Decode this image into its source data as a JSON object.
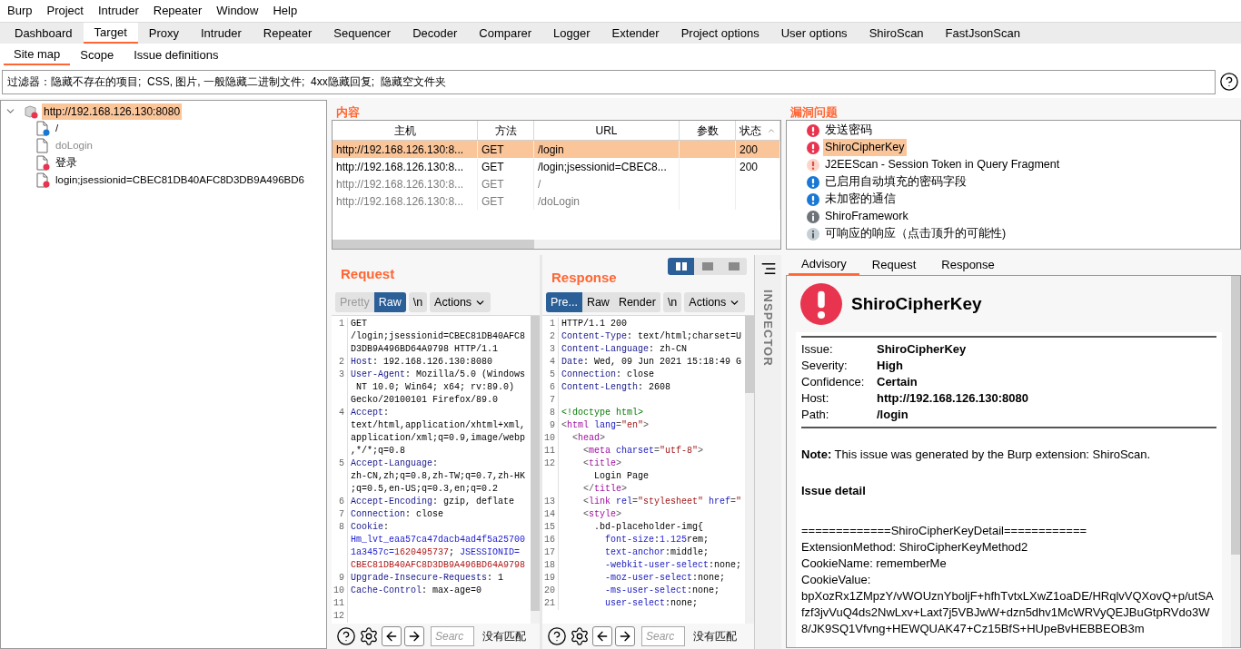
{
  "menu": [
    "Burp",
    "Project",
    "Intruder",
    "Repeater",
    "Window",
    "Help"
  ],
  "tabs": [
    {
      "label": "Dashboard",
      "selected": false
    },
    {
      "label": "Target",
      "selected": true
    },
    {
      "label": "Proxy",
      "selected": false
    },
    {
      "label": "Intruder",
      "selected": false
    },
    {
      "label": "Repeater",
      "selected": false
    },
    {
      "label": "Sequencer",
      "selected": false
    },
    {
      "label": "Decoder",
      "selected": false
    },
    {
      "label": "Comparer",
      "selected": false
    },
    {
      "label": "Logger",
      "selected": false
    },
    {
      "label": "Extender",
      "selected": false
    },
    {
      "label": "Project options",
      "selected": false
    },
    {
      "label": "User options",
      "selected": false
    },
    {
      "label": "ShiroScan",
      "selected": false
    },
    {
      "label": "FastJsonScan",
      "selected": false
    }
  ],
  "subtabs": [
    {
      "label": "Site map",
      "selected": true
    },
    {
      "label": "Scope",
      "selected": false
    },
    {
      "label": "Issue definitions",
      "selected": false
    }
  ],
  "filter": "过滤器：隐藏不存在的项目;  CSS, 图片, 一般隐藏二进制文件;  4xx隐藏回复;  隐藏空文件夹",
  "site_tree": [
    {
      "label": "http://192.168.126.130:8080",
      "selected": true,
      "expanded": true,
      "color": "#e8344e",
      "dimmed": false,
      "children": [
        {
          "label": "/",
          "selected": false,
          "color": "#1a78d4",
          "dimmed": false
        },
        {
          "label": "doLogin",
          "selected": false,
          "dimmed": true
        },
        {
          "label": "登录",
          "selected": false,
          "color": "#e8344e",
          "dimmed": false
        },
        {
          "label": "login;jsessionid=CBEC81DB40AFC8D3DB9A496BD6",
          "selected": false,
          "color": "#e8344e",
          "dimmed": false
        }
      ]
    }
  ],
  "content": {
    "title": "内容",
    "columns": [
      "主机",
      "方法",
      "URL",
      "参数",
      "状态"
    ],
    "rows": [
      {
        "cells": [
          "http://192.168.126.130:8...",
          "GET",
          "/login",
          "",
          "200"
        ],
        "selected": true,
        "dimmed": false
      },
      {
        "cells": [
          "http://192.168.126.130:8...",
          "GET",
          "/login;jsessionid=CBEC8...",
          "",
          "200"
        ],
        "selected": false,
        "dimmed": false
      },
      {
        "cells": [
          "http://192.168.126.130:8...",
          "GET",
          "/",
          "",
          ""
        ],
        "selected": false,
        "dimmed": true
      },
      {
        "cells": [
          "http://192.168.126.130:8...",
          "GET",
          "/doLogin",
          "",
          ""
        ],
        "selected": false,
        "dimmed": true
      }
    ]
  },
  "issues": {
    "title": "漏洞问题",
    "items": [
      {
        "label": "发送密码",
        "kind": "high",
        "selected": false
      },
      {
        "label": "ShiroCipherKey",
        "kind": "high",
        "selected": true
      },
      {
        "label": "J2EEScan - Session Token in Query Fragment",
        "kind": "tentative",
        "selected": false
      },
      {
        "label": "已启用自动填充的密码字段",
        "kind": "low",
        "selected": false
      },
      {
        "label": "未加密的通信",
        "kind": "low",
        "selected": false
      },
      {
        "label": "ShiroFramework",
        "kind": "info",
        "selected": false
      },
      {
        "label": "可响应的响应（点击顶升的可能性)",
        "kind": "hint",
        "selected": false
      }
    ]
  },
  "request": {
    "title": "Request",
    "views": [
      {
        "label": "Pretty",
        "selected": false,
        "disabled": true
      },
      {
        "label": "Raw",
        "selected": true,
        "disabled": false
      }
    ],
    "newline": "\\n",
    "actions": "Actions",
    "search_placeholder": "Searc",
    "match": "没有匹配",
    "lines": [
      {
        "n": "1",
        "s": [
          {
            "kind": "plain",
            "text": "GET"
          }
        ]
      },
      {
        "s": [
          {
            "kind": "plain",
            "text": "/login;jsessionid=CBEC81DB40AFC8"
          }
        ]
      },
      {
        "s": [
          {
            "kind": "plain",
            "text": "D3DB9A496BD64A9798 HTTP/1.1"
          }
        ]
      },
      {
        "n": "2",
        "s": [
          {
            "kind": "key",
            "text": "Host"
          },
          {
            "kind": "plain",
            "text": ": 192.168.126.130:8080"
          }
        ]
      },
      {
        "n": "3",
        "s": [
          {
            "kind": "key",
            "text": "User-Agent"
          },
          {
            "kind": "plain",
            "text": ": Mozilla/5.0 (Windows"
          }
        ]
      },
      {
        "s": [
          {
            "kind": "plain",
            "text": " NT 10.0; Win64; x64; rv:89.0)"
          }
        ]
      },
      {
        "s": [
          {
            "kind": "plain",
            "text": "Gecko/20100101 Firefox/89.0"
          }
        ]
      },
      {
        "n": "4",
        "s": [
          {
            "kind": "key",
            "text": "Accept"
          },
          {
            "kind": "plain",
            "text": ":"
          }
        ]
      },
      {
        "s": [
          {
            "kind": "plain",
            "text": "text/html,application/xhtml+xml,"
          }
        ]
      },
      {
        "s": [
          {
            "kind": "plain",
            "text": "application/xml;q=0.9,image/webp"
          }
        ]
      },
      {
        "s": [
          {
            "kind": "plain",
            "text": ",*/*;q=0.8"
          }
        ]
      },
      {
        "n": "5",
        "s": [
          {
            "kind": "key",
            "text": "Accept-Language"
          },
          {
            "kind": "plain",
            "text": ":"
          }
        ]
      },
      {
        "s": [
          {
            "kind": "plain",
            "text": "zh-CN,zh;q=0.8,zh-TW;q=0.7,zh-HK"
          }
        ]
      },
      {
        "s": [
          {
            "kind": "plain",
            "text": ";q=0.5,en-US;q=0.3,en;q=0.2"
          }
        ]
      },
      {
        "n": "6",
        "s": [
          {
            "kind": "key",
            "text": "Accept-Encoding"
          },
          {
            "kind": "plain",
            "text": ": gzip, deflate"
          }
        ]
      },
      {
        "n": "7",
        "s": [
          {
            "kind": "key",
            "text": "Connection"
          },
          {
            "kind": "plain",
            "text": ": close"
          }
        ]
      },
      {
        "n": "8",
        "s": [
          {
            "kind": "key",
            "text": "Cookie"
          },
          {
            "kind": "plain",
            "text": ":"
          }
        ]
      },
      {
        "s": [
          {
            "kind": "cname",
            "text": "Hm_lvt_eaa57ca47dacb4ad4f5a25700"
          }
        ]
      },
      {
        "s": [
          {
            "kind": "cname",
            "text": "1a3457c="
          },
          {
            "kind": "cval",
            "text": "1620495737"
          },
          {
            "kind": "plain",
            "text": "; "
          },
          {
            "kind": "cname",
            "text": "JSESSIONID="
          }
        ]
      },
      {
        "s": [
          {
            "kind": "cval",
            "text": "CBEC81DB40AFC8D3DB9A496BD64A9798"
          }
        ]
      },
      {
        "n": "9",
        "s": [
          {
            "kind": "key",
            "text": "Upgrade-Insecure-Requests"
          },
          {
            "kind": "plain",
            "text": ": 1"
          }
        ]
      },
      {
        "n": "10",
        "s": [
          {
            "kind": "key",
            "text": "Cache-Control"
          },
          {
            "kind": "plain",
            "text": ": max-age=0"
          }
        ]
      },
      {
        "n": "11"
      },
      {
        "n": "12"
      }
    ]
  },
  "response": {
    "title": "Response",
    "layouts": [
      {
        "selected": true
      },
      {
        "selected": false
      },
      {
        "selected": false
      }
    ],
    "views": [
      {
        "label": "Pre...",
        "selected": true,
        "disabled": false
      },
      {
        "label": "Raw",
        "selected": false,
        "disabled": false
      },
      {
        "label": "Render",
        "selected": false,
        "disabled": false
      }
    ],
    "newline": "\\n",
    "actions": "Actions",
    "search_placeholder": "Searc",
    "match": "没有匹配",
    "lines": [
      {
        "n": "1",
        "s": [
          {
            "kind": "plain",
            "text": "HTTP/1.1 200"
          }
        ]
      },
      {
        "n": "2",
        "s": [
          {
            "kind": "key",
            "text": "Content-Type"
          },
          {
            "kind": "plain",
            "text": ": text/html;charset=U"
          }
        ]
      },
      {
        "n": "3",
        "s": [
          {
            "kind": "key",
            "text": "Content-Language"
          },
          {
            "kind": "plain",
            "text": ": zh-CN"
          }
        ]
      },
      {
        "n": "4",
        "s": [
          {
            "kind": "key",
            "text": "Date"
          },
          {
            "kind": "plain",
            "text": ": Wed, 09 Jun 2021 15:18:49 G"
          }
        ]
      },
      {
        "n": "5",
        "s": [
          {
            "kind": "key",
            "text": "Connection"
          },
          {
            "kind": "plain",
            "text": ": close"
          }
        ]
      },
      {
        "n": "6",
        "s": [
          {
            "kind": "key",
            "text": "Content-Length"
          },
          {
            "kind": "plain",
            "text": ": 2608"
          }
        ]
      },
      {
        "n": "7"
      },
      {
        "n": "8",
        "s": [
          {
            "kind": "doctype",
            "text": "<!doctype html>"
          }
        ]
      },
      {
        "n": "9",
        "s": [
          {
            "kind": "punct",
            "text": "<"
          },
          {
            "kind": "tag",
            "text": "html"
          },
          {
            "kind": "attr",
            "text": " lang"
          },
          {
            "kind": "punct",
            "text": "="
          },
          {
            "kind": "str",
            "text": "\"en\""
          },
          {
            "kind": "punct",
            "text": ">"
          }
        ]
      },
      {
        "n": "10",
        "s": [
          {
            "kind": "punct",
            "text": "  <"
          },
          {
            "kind": "tag",
            "text": "head"
          },
          {
            "kind": "punct",
            "text": ">"
          }
        ]
      },
      {
        "n": "11",
        "s": [
          {
            "kind": "punct",
            "text": "    <"
          },
          {
            "kind": "tag",
            "text": "meta"
          },
          {
            "kind": "attr",
            "text": " charset"
          },
          {
            "kind": "punct",
            "text": "="
          },
          {
            "kind": "str",
            "text": "\"utf-8\""
          },
          {
            "kind": "punct",
            "text": ">"
          }
        ]
      },
      {
        "n": "12",
        "s": [
          {
            "kind": "punct",
            "text": "    <"
          },
          {
            "kind": "tag",
            "text": "title"
          },
          {
            "kind": "punct",
            "text": ">"
          }
        ]
      },
      {
        "s": [
          {
            "kind": "plain",
            "text": "      Login Page"
          }
        ]
      },
      {
        "s": [
          {
            "kind": "punct",
            "text": "    </"
          },
          {
            "kind": "tag",
            "text": "title"
          },
          {
            "kind": "punct",
            "text": ">"
          }
        ]
      },
      {
        "n": "13",
        "s": [
          {
            "kind": "punct",
            "text": "    <"
          },
          {
            "kind": "tag",
            "text": "link"
          },
          {
            "kind": "attr",
            "text": " rel"
          },
          {
            "kind": "punct",
            "text": "="
          },
          {
            "kind": "str",
            "text": "\"stylesheet\""
          },
          {
            "kind": "attr",
            "text": " href"
          },
          {
            "kind": "punct",
            "text": "="
          },
          {
            "kind": "str",
            "text": "\""
          }
        ]
      },
      {
        "n": "14",
        "s": [
          {
            "kind": "punct",
            "text": "    <"
          },
          {
            "kind": "tag",
            "text": "style"
          },
          {
            "kind": "punct",
            "text": ">"
          }
        ]
      },
      {
        "n": "15",
        "s": [
          {
            "kind": "plain",
            "text": "      .bd-placeholder-img{"
          }
        ]
      },
      {
        "n": "16",
        "s": [
          {
            "kind": "prop",
            "text": "        font-size"
          },
          {
            "kind": "plain",
            "text": ":"
          },
          {
            "kind": "num",
            "text": "1.125"
          },
          {
            "kind": "plain",
            "text": "rem;"
          }
        ]
      },
      {
        "n": "17",
        "s": [
          {
            "kind": "prop",
            "text": "        text-anchor"
          },
          {
            "kind": "plain",
            "text": ":middle;"
          }
        ]
      },
      {
        "n": "18",
        "s": [
          {
            "kind": "prop",
            "text": "        -webkit-user-select"
          },
          {
            "kind": "plain",
            "text": ":none;"
          }
        ]
      },
      {
        "n": "19",
        "s": [
          {
            "kind": "prop",
            "text": "        -moz-user-select"
          },
          {
            "kind": "plain",
            "text": ":none;"
          }
        ]
      },
      {
        "n": "20",
        "s": [
          {
            "kind": "prop",
            "text": "        -ms-user-select"
          },
          {
            "kind": "plain",
            "text": ":none;"
          }
        ]
      },
      {
        "n": "21",
        "s": [
          {
            "kind": "prop",
            "text": "        user-select"
          },
          {
            "kind": "plain",
            "text": ":none;"
          }
        ]
      }
    ]
  },
  "inspector": "INSPECTOR",
  "advisory": {
    "tabs": [
      {
        "label": "Advisory",
        "selected": true
      },
      {
        "label": "Request",
        "selected": false
      },
      {
        "label": "Response",
        "selected": false
      }
    ],
    "title": "ShiroCipherKey",
    "kind": "high",
    "fields": [
      {
        "label": "Issue:",
        "value": "ShiroCipherKey"
      },
      {
        "label": "Severity:",
        "value": "High"
      },
      {
        "label": "Confidence:",
        "value": "Certain"
      },
      {
        "label": "Host:",
        "value": "http://192.168.126.130:8080"
      },
      {
        "label": "Path:",
        "value": "/login"
      }
    ],
    "note": "**Note:** This issue was generated by the Burp extension: ShiroScan.",
    "detail_heading": "Issue detail",
    "detail_lines": [
      "=============ShiroCipherKeyDetail============",
      "ExtensionMethod: ShiroCipherKeyMethod2",
      "CookieName: rememberMe",
      "CookieValue:",
      "bpXozRx1ZMpzY/vWOUznYboljF+hfhTvtxLXwZ1oaDE/HRqlvVQXovQ+p/utSAfzf3jvVuQ4ds2NwLxv+Laxt7j5VBJwW+dzn5dhv1McWRVyQEJBuGtpRVdo3W8/JK9SQ1Vfvng+HEWQUAK47+Cz15BfS+HUpeBvHEBBEOB3m"
    ]
  }
}
